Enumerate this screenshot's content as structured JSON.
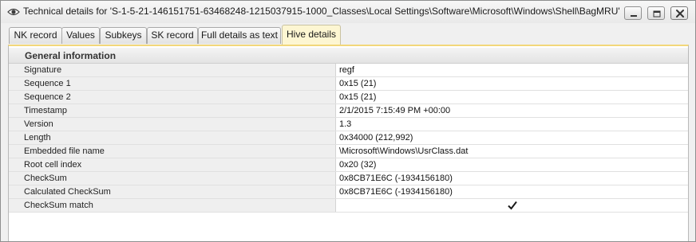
{
  "window": {
    "title": "Technical details for 'S-1-5-21-146151751-63468248-1215037915-1000_Classes\\Local Settings\\Software\\Microsoft\\Windows\\Shell\\BagMRU'"
  },
  "tabs": [
    {
      "label": "NK record"
    },
    {
      "label": "Values"
    },
    {
      "label": "Subkeys"
    },
    {
      "label": "SK record"
    },
    {
      "label": "Full details as text"
    },
    {
      "label": "Hive details",
      "active": true
    }
  ],
  "group": {
    "label": "General information"
  },
  "rows": [
    {
      "key": "Signature",
      "value": "regf"
    },
    {
      "key": "Sequence 1",
      "value": "0x15 (21)"
    },
    {
      "key": "Sequence 2",
      "value": "0x15 (21)"
    },
    {
      "key": "Timestamp",
      "value": "2/1/2015 7:15:49 PM +00:00"
    },
    {
      "key": "Version",
      "value": "1.3"
    },
    {
      "key": "Length",
      "value": "0x34000 (212,992)"
    },
    {
      "key": "Embedded file name",
      "value": "\\Microsoft\\Windows\\UsrClass.dat"
    },
    {
      "key": "Root cell index",
      "value": "0x20 (32)"
    },
    {
      "key": "CheckSum",
      "value": "0x8CB71E6C (-1934156180)"
    },
    {
      "key": "Calculated CheckSum",
      "value": "0x8CB71E6C (-1934156180)"
    },
    {
      "key": "CheckSum match",
      "checked": true
    }
  ],
  "icons": {
    "title": "eye-icon",
    "minimize": "minimize-icon",
    "restore": "restore-icon",
    "close": "close-icon",
    "check": "checkmark-icon"
  },
  "colors": {
    "active_tab": "#fdf6d2",
    "close_button": "#c9453c",
    "tab_accent": "#f2d77a"
  }
}
